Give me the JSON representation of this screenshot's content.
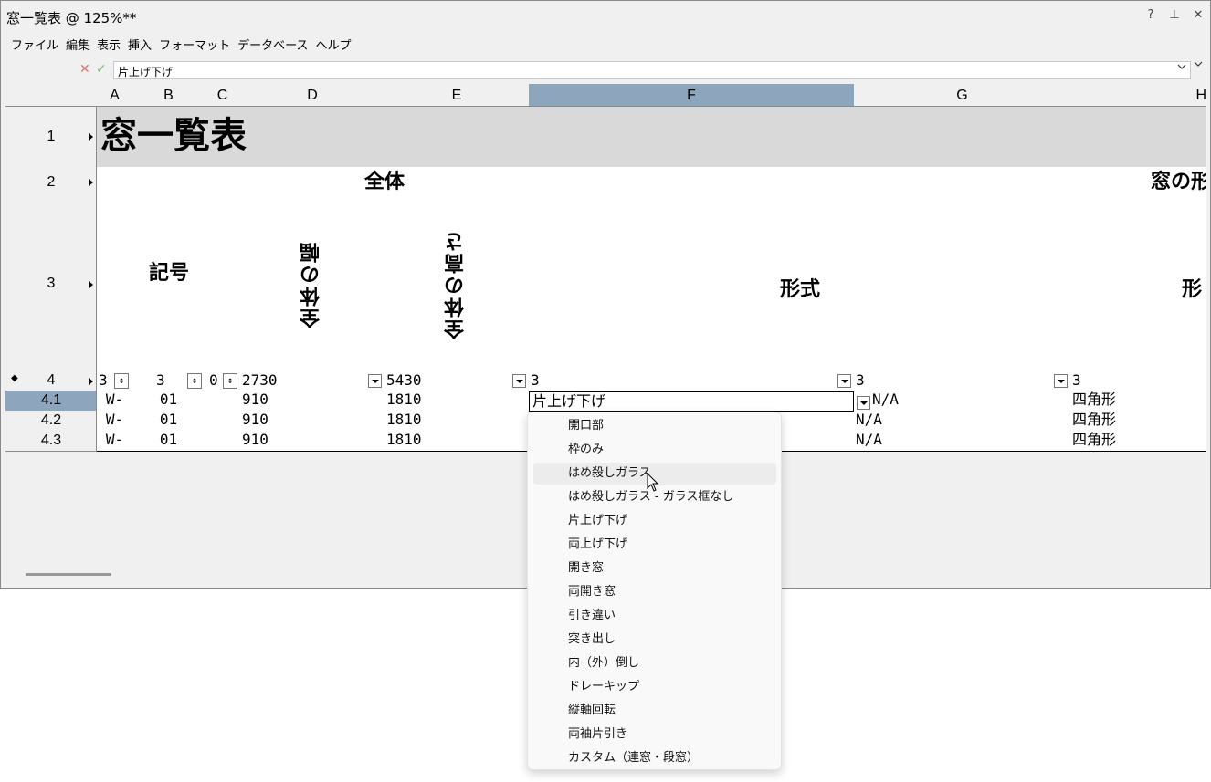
{
  "window": {
    "title": "窓一覧表 @ 125%**",
    "help_glyph": "?",
    "pin_glyph": "⊥",
    "close_glyph": "✕"
  },
  "menu": [
    "ファイル",
    "編集",
    "表示",
    "挿入",
    "フォーマット",
    "データベース",
    "ヘルプ"
  ],
  "formula": {
    "value": "片上げ下げ",
    "cancel_glyph": "✕",
    "ok_glyph": "✓"
  },
  "columns": [
    "A",
    "B",
    "C",
    "D",
    "E",
    "F",
    "G",
    "H"
  ],
  "selected_column": "F",
  "rows": {
    "r1": "1",
    "r2": "2",
    "r3": "3",
    "r4": "4",
    "r41": "4.1",
    "r42": "4.2",
    "r43": "4.3"
  },
  "sheet": {
    "title": "窓一覧表",
    "group_all": "全体",
    "group_window": "窓の形",
    "symbol": "記号",
    "width": "全体の幅",
    "height": "全体の高さ",
    "type": "形式",
    "shape": "形",
    "row4": {
      "a": "3",
      "b": "3",
      "c": "0",
      "d": "2730",
      "e": "5430",
      "f": "3",
      "g": "3",
      "h": "3"
    },
    "data_rows": [
      {
        "a": "W-",
        "b": "01",
        "d": "910",
        "e": "1810",
        "f": "片上げ下げ",
        "g": "N/A",
        "h": "四角形"
      },
      {
        "a": "W-",
        "b": "01",
        "d": "910",
        "e": "1810",
        "f": "",
        "g": "N/A",
        "h": "四角形"
      },
      {
        "a": "W-",
        "b": "01",
        "d": "910",
        "e": "1810",
        "f": "",
        "g": "N/A",
        "h": "四角形"
      }
    ]
  },
  "dropdown": {
    "items": [
      "開口部",
      "枠のみ",
      "はめ殺しガラス",
      "はめ殺しガラス - ガラス框なし",
      "片上げ下げ",
      "両上げ下げ",
      "開き窓",
      "両開き窓",
      "引き違い",
      "突き出し",
      "内（外）倒し",
      "ドレーキップ",
      "縦軸回転",
      "両袖片引き",
      "カスタム（連窓・段窓）"
    ],
    "hovered_index": 2
  }
}
